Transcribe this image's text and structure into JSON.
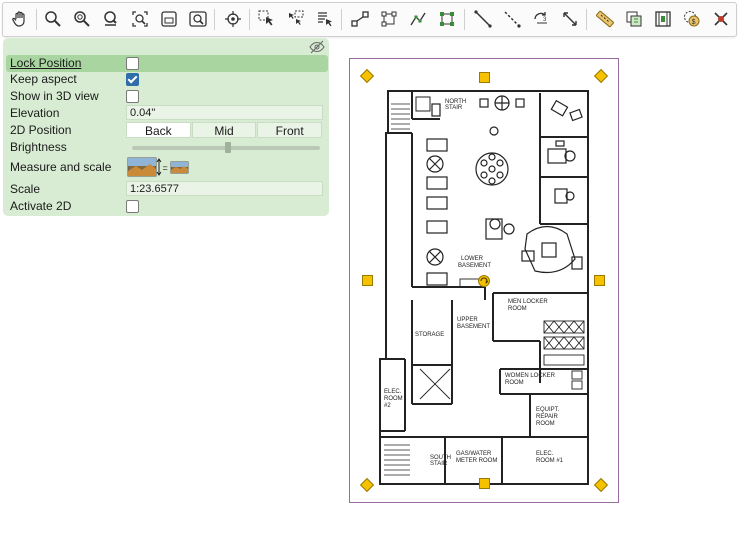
{
  "toolbar": {
    "tools": [
      {
        "icon": "pan-hand-icon"
      },
      {
        "icon": "zoom-icon"
      },
      {
        "icon": "zoom-in-icon"
      },
      {
        "icon": "zoom-out-icon"
      },
      {
        "icon": "zoom-fit-icon"
      },
      {
        "icon": "zoom-page-icon"
      },
      {
        "icon": "zoom-window-icon"
      },
      {
        "icon": "snap-target-icon"
      },
      {
        "icon": "select-icon"
      },
      {
        "icon": "select-multiple-icon"
      },
      {
        "icon": "select-list-icon"
      },
      {
        "icon": "move-points-icon"
      },
      {
        "icon": "rotate-shape-icon"
      },
      {
        "icon": "edit-nodes-icon"
      },
      {
        "icon": "nodes-grid-icon"
      },
      {
        "icon": "line-icon"
      },
      {
        "icon": "dashed-line-icon"
      },
      {
        "icon": "rotate-3d-icon"
      },
      {
        "icon": "resize-arrows-icon"
      },
      {
        "icon": "ruler-icon"
      },
      {
        "icon": "copy-layers-icon"
      },
      {
        "icon": "film-frame-icon"
      },
      {
        "icon": "cost-icon"
      },
      {
        "icon": "delete-icon"
      }
    ]
  },
  "properties": {
    "lock_position": {
      "label": "Lock Position",
      "checked": false
    },
    "keep_aspect": {
      "label": "Keep aspect",
      "checked": true
    },
    "show_3d": {
      "label": "Show in 3D view",
      "checked": false
    },
    "elevation": {
      "label": "Elevation",
      "value": "0.04\""
    },
    "position_2d": {
      "label": "2D Position",
      "options": [
        "Back",
        "Mid",
        "Front"
      ],
      "selected": "Back"
    },
    "brightness": {
      "label": "Brightness",
      "level": 0.5
    },
    "measure": {
      "label": "Measure and scale"
    },
    "scale": {
      "label": "Scale",
      "value": "1:23.6577"
    },
    "activate_2d": {
      "label": "Activate 2D",
      "checked": false
    }
  },
  "floorplan": {
    "rooms": {
      "north_stair": "NORTH\nSTAIR",
      "lower_basement": "LOWER\nBASEMENT",
      "men_locker": "MEN LOCKER\nROOM",
      "storage": "STORAGE",
      "upper_basement": "UPPER\nBASEMENT",
      "women_locker": "WOMEN LOCKER\nROOM",
      "elec_2": "ELEC.\nROOM\n#2",
      "equip_repair": "EQUIPT.\nREPAIR\nROOM",
      "south_stair": "SOUTH\nSTAIR",
      "gas_water": "GAS/WATER\nMETER ROOM",
      "elec_1": "ELEC.\nROOM #1"
    }
  },
  "colors": {
    "panel": "#d8ecd3",
    "selected_row": "#a9d6a0",
    "handle": "#f6c200",
    "frame": "#9b6aa3",
    "accent": "#2f6ea8"
  }
}
